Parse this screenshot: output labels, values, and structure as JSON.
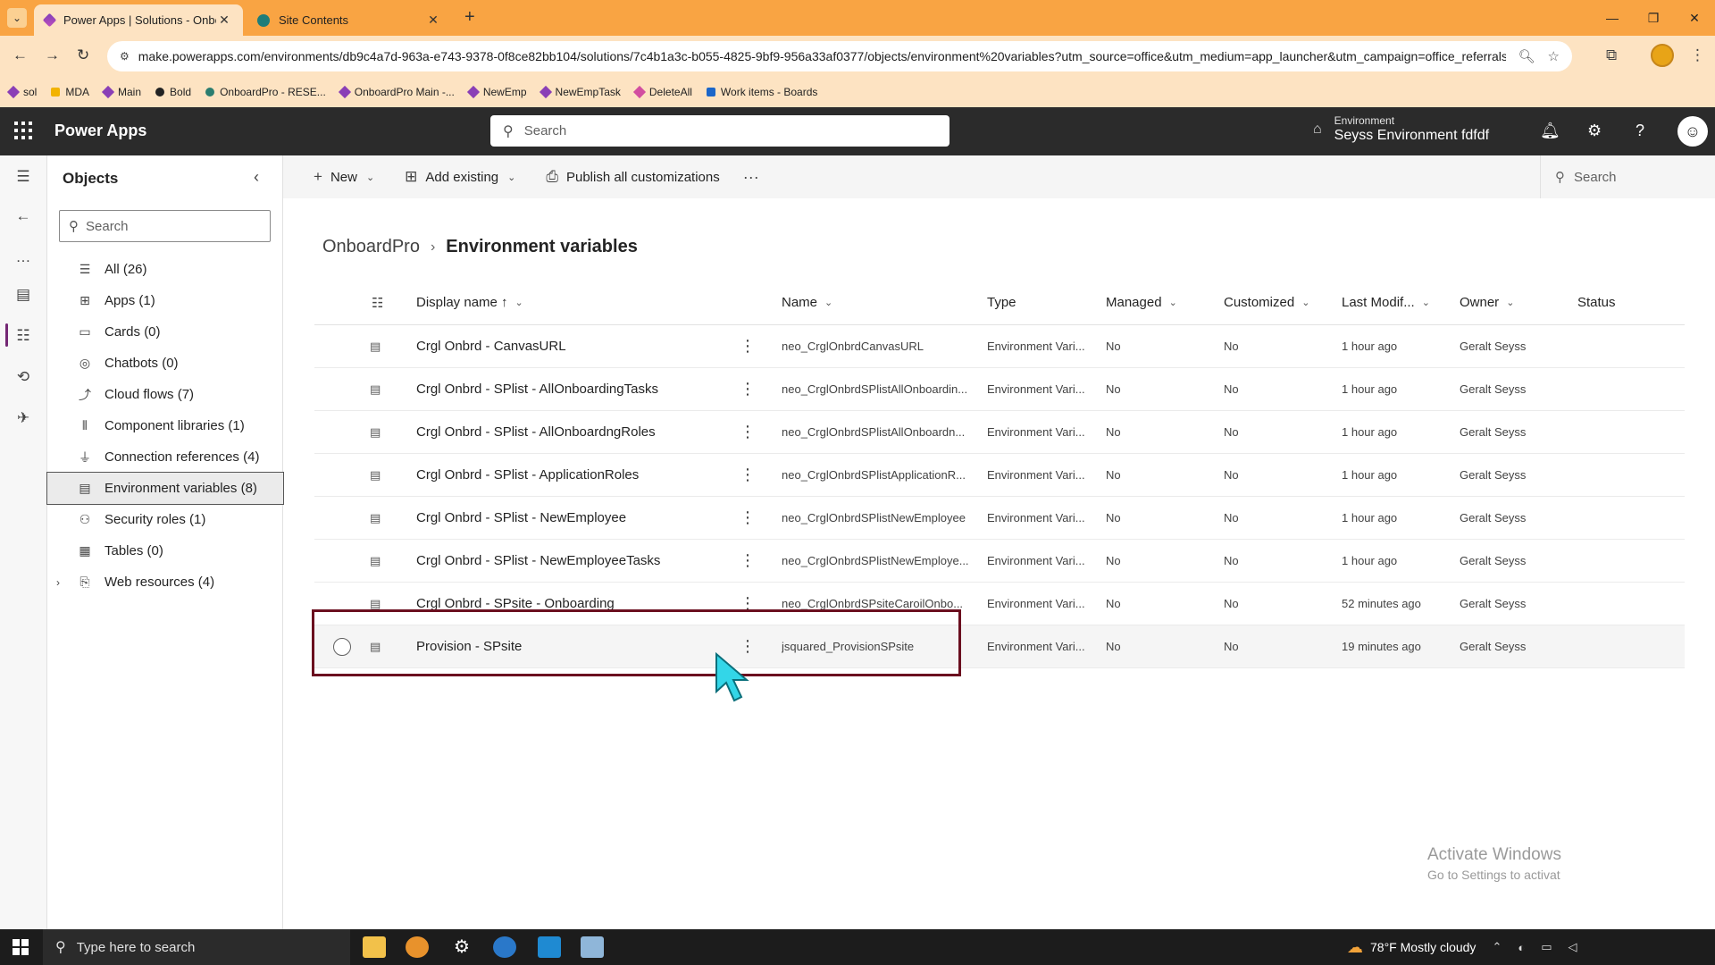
{
  "browser": {
    "tabs": [
      {
        "title": "Power Apps | Solutions - Onboa",
        "favicon": "power-apps-icon"
      },
      {
        "title": "Site Contents",
        "favicon": "sharepoint-icon"
      }
    ],
    "url": "make.powerapps.com/environments/db9c4a7d-963a-e743-9378-0f8ce82bb104/solutions/7c4b1a3c-b055-4825-9bf9-956a33af0377/objects/environment%20variables?utm_source=office&utm_medium=app_launcher&utm_campaign=office_referrals",
    "bookmarks": [
      "sol",
      "MDA",
      "Main",
      "Bold",
      "OnboardPro - RESE...",
      "OnboardPro Main -...",
      "NewEmp",
      "NewEmpTask",
      "DeleteAll",
      "Work items - Boards"
    ]
  },
  "header": {
    "app_name": "Power Apps",
    "search_placeholder": "Search",
    "environment_label": "Environment",
    "environment_name": "Seyss Environment fdfdf"
  },
  "objects": {
    "title": "Objects",
    "search_placeholder": "Search",
    "items": [
      {
        "label": "All",
        "count": "(26)",
        "icon": "list-icon"
      },
      {
        "label": "Apps",
        "count": "(1)",
        "icon": "apps-icon"
      },
      {
        "label": "Cards",
        "count": "(0)",
        "icon": "cards-icon"
      },
      {
        "label": "Chatbots",
        "count": "(0)",
        "icon": "chatbot-icon"
      },
      {
        "label": "Cloud flows",
        "count": "(7)",
        "icon": "flow-icon"
      },
      {
        "label": "Component libraries",
        "count": "(1)",
        "icon": "library-icon"
      },
      {
        "label": "Connection references",
        "count": "(4)",
        "icon": "plug-icon"
      },
      {
        "label": "Environment variables",
        "count": "(8)",
        "icon": "environment-variable-icon"
      },
      {
        "label": "Security roles",
        "count": "(1)",
        "icon": "security-role-icon"
      },
      {
        "label": "Tables",
        "count": "(0)",
        "icon": "table-icon"
      },
      {
        "label": "Web resources",
        "count": "(4)",
        "icon": "web-resource-icon"
      }
    ]
  },
  "commands": {
    "new": "New",
    "add_existing": "Add existing",
    "publish": "Publish all customizations",
    "search": "Search"
  },
  "breadcrumb": {
    "parent": "OnboardPro",
    "current": "Environment variables"
  },
  "grid": {
    "columns": {
      "display_name": "Display name",
      "name": "Name",
      "type": "Type",
      "managed": "Managed",
      "customized": "Customized",
      "last_modified": "Last Modif...",
      "owner": "Owner",
      "status": "Status"
    },
    "sort_indicator": "↑",
    "rows": [
      {
        "display_name": "Crgl Onbrd - CanvasURL",
        "name": "neo_CrglOnbrdCanvasURL",
        "type": "Environment Vari...",
        "managed": "No",
        "customized": "No",
        "last_modified": "1 hour ago",
        "owner": "Geralt Seyss",
        "status": ""
      },
      {
        "display_name": "Crgl Onbrd - SPlist - AllOnboardingTasks",
        "name": "neo_CrglOnbrdSPlistAllOnboardin...",
        "type": "Environment Vari...",
        "managed": "No",
        "customized": "No",
        "last_modified": "1 hour ago",
        "owner": "Geralt Seyss",
        "status": ""
      },
      {
        "display_name": "Crgl Onbrd - SPlist - AllOnboardngRoles",
        "name": "neo_CrglOnbrdSPlistAllOnboardn...",
        "type": "Environment Vari...",
        "managed": "No",
        "customized": "No",
        "last_modified": "1 hour ago",
        "owner": "Geralt Seyss",
        "status": ""
      },
      {
        "display_name": "Crgl Onbrd - SPlist - ApplicationRoles",
        "name": "neo_CrglOnbrdSPlistApplicationR...",
        "type": "Environment Vari...",
        "managed": "No",
        "customized": "No",
        "last_modified": "1 hour ago",
        "owner": "Geralt Seyss",
        "status": ""
      },
      {
        "display_name": "Crgl Onbrd - SPlist - NewEmployee",
        "name": "neo_CrglOnbrdSPlistNewEmployee",
        "type": "Environment Vari...",
        "managed": "No",
        "customized": "No",
        "last_modified": "1 hour ago",
        "owner": "Geralt Seyss",
        "status": ""
      },
      {
        "display_name": "Crgl Onbrd - SPlist - NewEmployeeTasks",
        "name": "neo_CrglOnbrdSPlistNewEmploye...",
        "type": "Environment Vari...",
        "managed": "No",
        "customized": "No",
        "last_modified": "1 hour ago",
        "owner": "Geralt Seyss",
        "status": ""
      },
      {
        "display_name": "Crgl Onbrd - SPsite - Onboarding",
        "name": "neo_CrglOnbrdSPsiteCaroilOnbo...",
        "type": "Environment Vari...",
        "managed": "No",
        "customized": "No",
        "last_modified": "52 minutes ago",
        "owner": "Geralt Seyss",
        "status": ""
      },
      {
        "display_name": "Provision - SPsite",
        "name": "jsquared_ProvisionSPsite",
        "type": "Environment Vari...",
        "managed": "No",
        "customized": "No",
        "last_modified": "19 minutes ago",
        "owner": "Geralt Seyss",
        "status": ""
      }
    ]
  },
  "watermark": {
    "line1": "Activate Windows",
    "line2": "Go to Settings to activat"
  },
  "taskbar": {
    "search_placeholder": "Type here to search",
    "temperature": "78°F",
    "weather": "Mostly cloudy"
  },
  "colors": {
    "browser_frame": "#f9a443",
    "app_header": "#2b2b2b",
    "accent": "#742774",
    "highlight_box": "#6b0f1f"
  }
}
